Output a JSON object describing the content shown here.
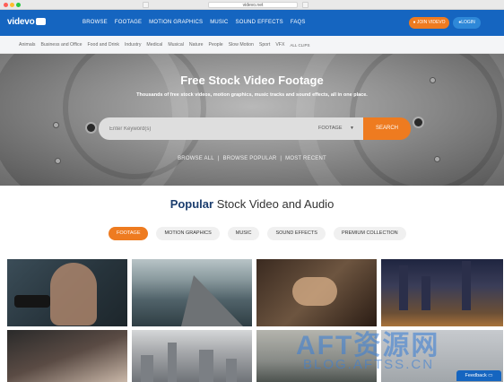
{
  "browser": {
    "url": "videvo.net"
  },
  "brand": {
    "name": "videvo"
  },
  "nav": {
    "links": [
      "BROWSE",
      "FOOTAGE",
      "MOTION GRAPHICS",
      "MUSIC",
      "SOUND EFFECTS",
      "FAQS"
    ],
    "join_label": "JOIN VIDEVO",
    "login_label": "LOGIN"
  },
  "categories": [
    "Animals",
    "Business and Office",
    "Food and Drink",
    "Industry",
    "Medical",
    "Musical",
    "Nature",
    "People",
    "Slow Motion",
    "Sport",
    "VFX",
    "ALL CLIPS"
  ],
  "hero": {
    "title": "Free Stock Video Footage",
    "subtitle": "Thousands of free stock videos, motion graphics, music tracks and sound effects, all in one place.",
    "search_placeholder": "Enter Keyword(s)",
    "search_type": "FOOTAGE",
    "search_button": "SEARCH",
    "links": [
      "BROWSE ALL",
      "BROWSE POPULAR",
      "MOST RECENT"
    ]
  },
  "section": {
    "title_highlight": "Popular",
    "title_rest": "Stock Video and Audio"
  },
  "filters": [
    {
      "label": "FOOTAGE",
      "active": true
    },
    {
      "label": "MOTION GRAPHICS",
      "active": false
    },
    {
      "label": "MUSIC",
      "active": false
    },
    {
      "label": "SOUND EFFECTS",
      "active": false
    },
    {
      "label": "PREMIUM COLLECTION",
      "active": false
    }
  ],
  "watermark": {
    "line1": "AFT资源网",
    "line2": "BLOG.AFTSS.CN"
  },
  "feedback_label": "Feedback",
  "colors": {
    "primary": "#1565c0",
    "accent": "#ee7b20",
    "title_highlight": "#1b3d6e"
  }
}
